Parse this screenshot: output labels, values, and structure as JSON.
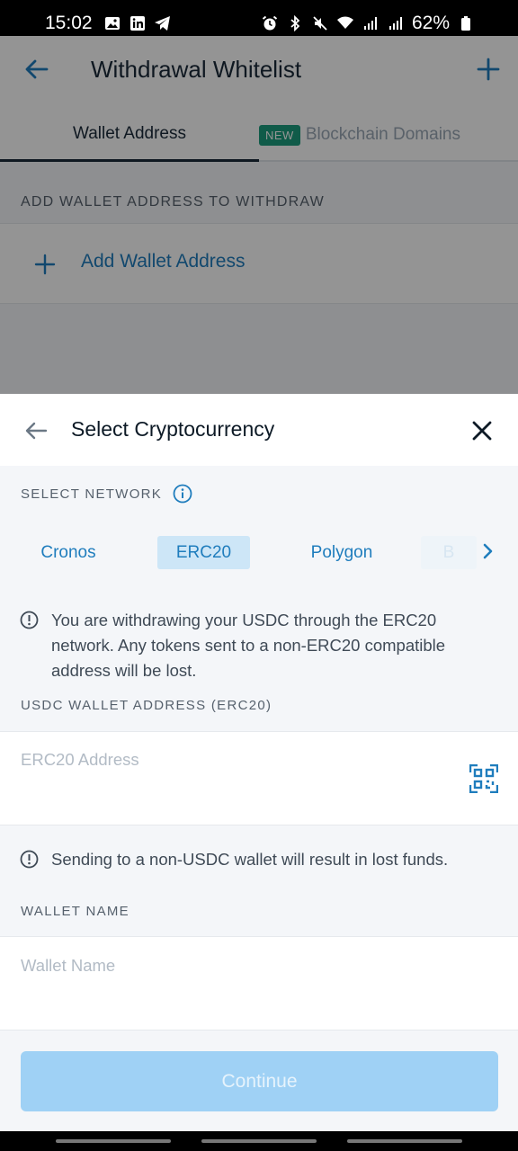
{
  "status_bar": {
    "time": "15:02",
    "battery": "62%"
  },
  "background_page": {
    "title": "Withdrawal Whitelist",
    "tabs": [
      {
        "label": "Wallet Address"
      },
      {
        "badge": "NEW",
        "label": "Blockchain Domains"
      }
    ],
    "section_label": "ADD WALLET ADDRESS TO WITHDRAW",
    "add_wallet_label": "Add Wallet Address"
  },
  "sheet": {
    "title": "Select Cryptocurrency",
    "select_network_label": "SELECT NETWORK",
    "networks": [
      {
        "label": "Cronos",
        "selected": false
      },
      {
        "label": "ERC20",
        "selected": true
      },
      {
        "label": "Polygon",
        "selected": false
      },
      {
        "label": "B",
        "selected": false
      }
    ],
    "network_warning": "You are withdrawing your USDC through the ERC20 network. Any tokens sent to a non-ERC20 compatible address will be lost.",
    "address_label": "USDC WALLET ADDRESS (ERC20)",
    "address_placeholder": "ERC20 Address",
    "funds_warning": "Sending to a non-USDC wallet will result in lost funds.",
    "wallet_name_label": "WALLET NAME",
    "wallet_name_placeholder": "Wallet Name",
    "continue_label": "Continue"
  },
  "colors": {
    "accent": "#1f7dbd",
    "button_disabled": "#9fd1f5",
    "new_badge": "#1d9e7e"
  }
}
